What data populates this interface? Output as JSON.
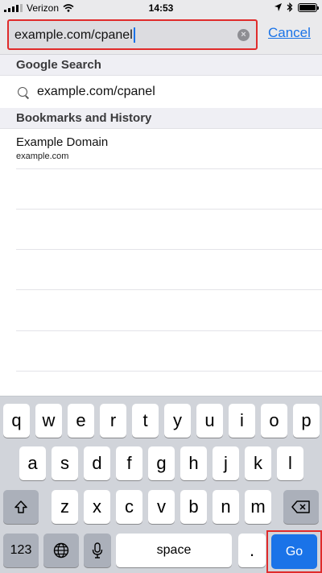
{
  "status": {
    "carrier": "Verizon",
    "time": "14:53"
  },
  "address_bar": {
    "value": "example.com/cpanel",
    "cancel_label": "Cancel"
  },
  "sections": {
    "google": {
      "title": "Google Search",
      "suggestion": "example.com/cpanel"
    },
    "bookmarks": {
      "title": "Bookmarks and History",
      "items": [
        {
          "title": "Example Domain",
          "url": "example.com"
        }
      ]
    }
  },
  "keyboard": {
    "row1": [
      "q",
      "w",
      "e",
      "r",
      "t",
      "y",
      "u",
      "i",
      "o",
      "p"
    ],
    "row2": [
      "a",
      "s",
      "d",
      "f",
      "g",
      "h",
      "j",
      "k",
      "l"
    ],
    "row3": [
      "z",
      "x",
      "c",
      "v",
      "b",
      "n",
      "m"
    ],
    "numbers_label": "123",
    "space_label": "space",
    "period_label": ".",
    "go_label": "Go",
    "icons": {
      "shift": "shift-icon",
      "backspace": "backspace-icon",
      "globe": "globe-icon",
      "mic": "microphone-icon"
    }
  },
  "colors": {
    "accent": "#1a73e8",
    "highlight": "#e02b2b"
  }
}
